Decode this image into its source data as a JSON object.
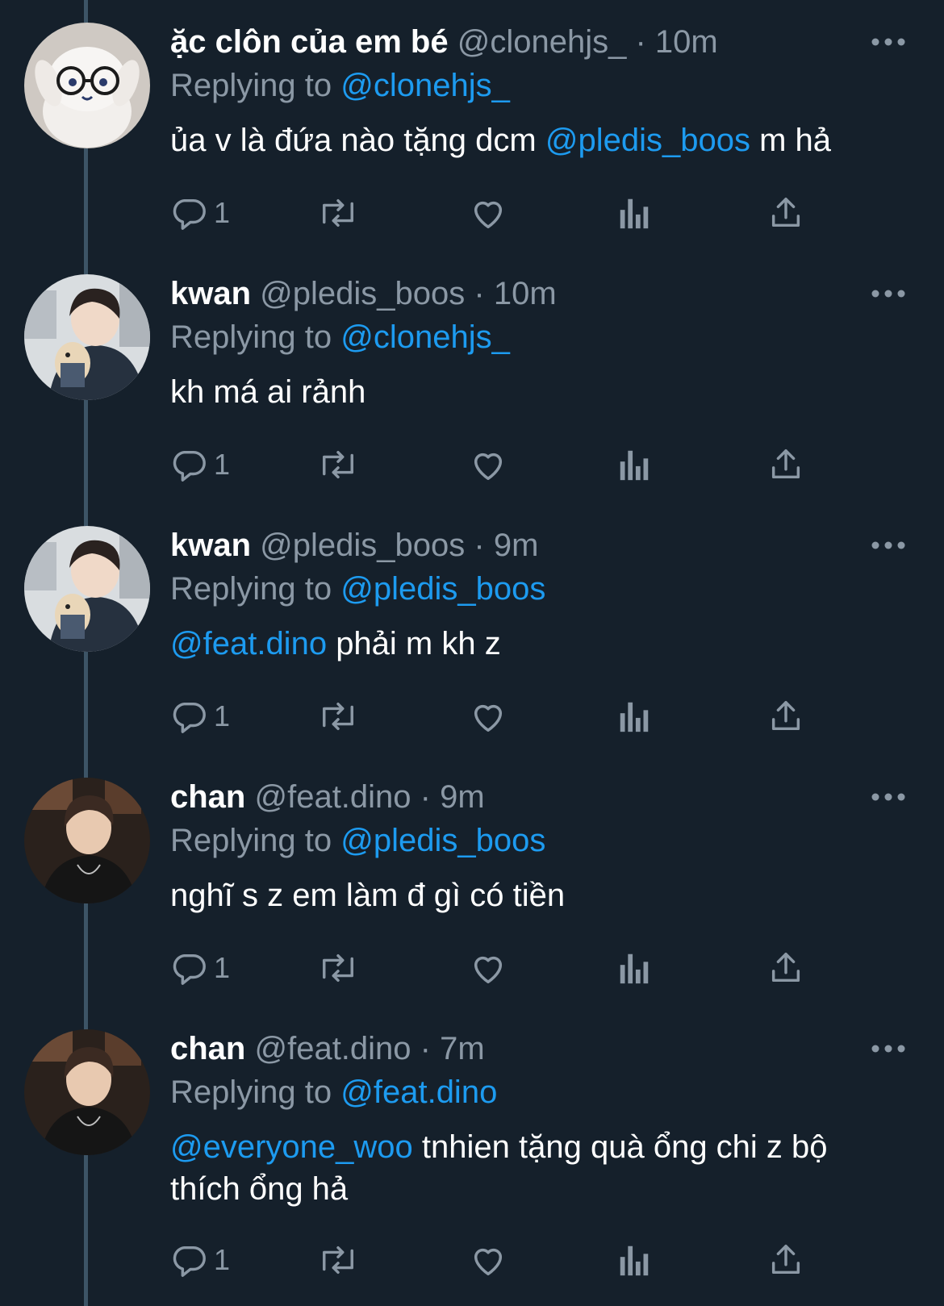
{
  "colors": {
    "background": "#15202b",
    "text": "#ffffff",
    "muted": "#8b98a5",
    "link": "#1d9bf0",
    "thread_line": "#3d5466"
  },
  "tweets": [
    {
      "name": "ặc clôn của em bé",
      "handle": "@clonehjs_",
      "time": "10m",
      "replying_label": "Replying to",
      "replying_to": "@clonehjs_",
      "text_before": "ủa v là đứa nào tặng dcm",
      "mention": "@pledis_boos",
      "text_after": "m hả",
      "reply_count": "1",
      "avatar": "plush-toy-with-glasses",
      "icons": [
        "reply-icon",
        "retweet-icon",
        "like-icon",
        "analytics-icon",
        "share-icon",
        "more-icon"
      ]
    },
    {
      "name": "kwan",
      "handle": "@pledis_boos",
      "time": "10m",
      "replying_label": "Replying to",
      "replying_to": "@clonehjs_",
      "text_before": "kh má ai rảnh",
      "reply_count": "1",
      "avatar": "person-holding-dog"
    },
    {
      "name": "kwan",
      "handle": "@pledis_boos",
      "time": "9m",
      "replying_label": "Replying to",
      "replying_to": "@pledis_boos",
      "mention_first": "@feat.dino",
      "text_after": "phải m kh z",
      "reply_count": "1",
      "avatar": "person-holding-dog"
    },
    {
      "name": "chan",
      "handle": "@feat.dino",
      "time": "9m",
      "replying_label": "Replying to",
      "replying_to": "@pledis_boos",
      "text_before": "nghĩ s z em làm đ gì có tiền",
      "reply_count": "1",
      "avatar": "person-black-shirt"
    },
    {
      "name": "chan",
      "handle": "@feat.dino",
      "time": "7m",
      "replying_label": "Replying to",
      "replying_to": "@feat.dino",
      "mention_first": "@everyone_woo",
      "text_after": "tnhien tặng quà ổng chi z bộ thích ổng hả",
      "reply_count": "1",
      "avatar": "person-black-shirt"
    }
  ]
}
